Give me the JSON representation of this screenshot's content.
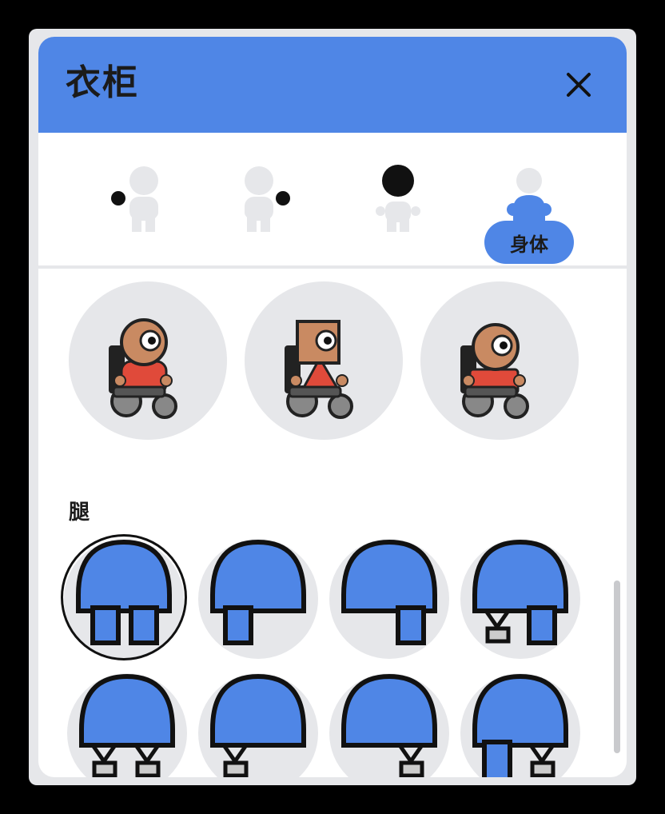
{
  "window": {
    "title": "衣柜"
  },
  "tabs": [
    {
      "id": "hand",
      "icon": "hand-icon"
    },
    {
      "id": "hand-right",
      "icon": "hand-icon"
    },
    {
      "id": "head",
      "icon": "head-icon"
    },
    {
      "id": "body",
      "icon": "body-icon",
      "label": "身体",
      "active": true
    }
  ],
  "sections": {
    "body_options": {
      "count": 3,
      "items": [
        "round-head-wheelchair",
        "square-head-wheelchair",
        "round-head-wheelchair-alt"
      ]
    },
    "legs": {
      "label": "腿",
      "items": [
        "two-legs",
        "one-leg-left",
        "one-leg-right",
        "prosthetic-left-leg-right",
        "two-prosthetics",
        "prosthetic-left",
        "prosthetic-right",
        "leg-left-prosthetic-right"
      ],
      "selected_index": 0
    }
  },
  "colors": {
    "accent": "#4f86e6",
    "skin": "#c98a62",
    "shirt": "#e04a3a",
    "placeholder": "#e6e7ea"
  }
}
